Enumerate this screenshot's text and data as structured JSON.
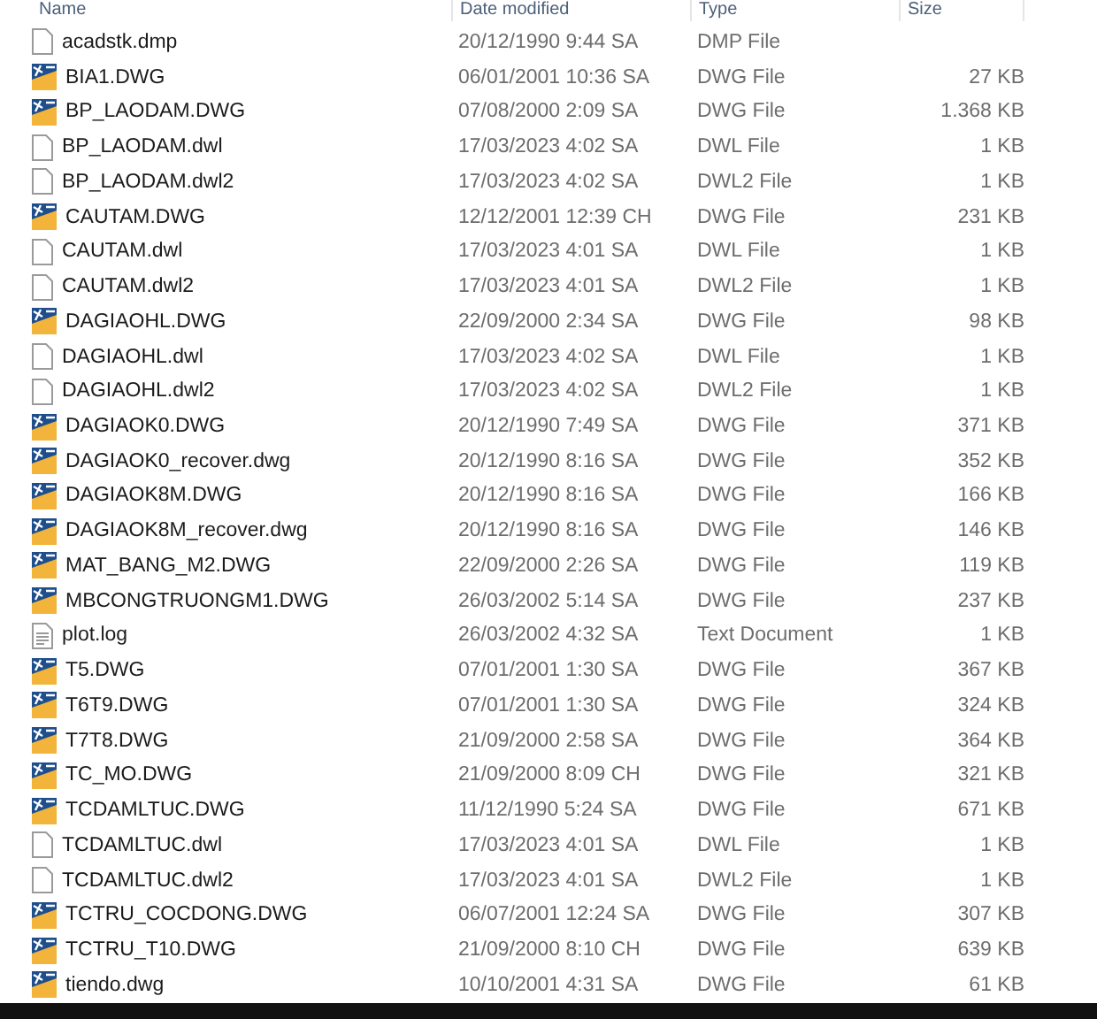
{
  "columns": [
    "Name",
    "Date modified",
    "Type",
    "Size"
  ],
  "files": [
    {
      "kind": "blank",
      "name": "acadstk.dmp",
      "date": "20/12/1990 9:44 SA",
      "type": "DMP File"
    },
    {
      "kind": "dwg",
      "name": "BIA1.DWG",
      "date": "06/01/2001 10:36 SA",
      "type": "DWG File",
      "size": "27 KB"
    },
    {
      "kind": "dwg",
      "name": "BP_LAODAM.DWG",
      "date": "07/08/2000 2:09 SA",
      "type": "DWG File",
      "size": "1.368 KB"
    },
    {
      "kind": "blank",
      "name": "BP_LAODAM.dwl",
      "date": "17/03/2023 4:02 SA",
      "type": "DWL File",
      "size": "1 KB"
    },
    {
      "kind": "blank",
      "name": "BP_LAODAM.dwl2",
      "date": "17/03/2023 4:02 SA",
      "type": "DWL2 File",
      "size": "1 KB"
    },
    {
      "kind": "dwg",
      "name": "CAUTAM.DWG",
      "date": "12/12/2001 12:39 CH",
      "type": "DWG File",
      "size": "231 KB"
    },
    {
      "kind": "blank",
      "name": "CAUTAM.dwl",
      "date": "17/03/2023 4:01 SA",
      "type": "DWL File",
      "size": "1 KB"
    },
    {
      "kind": "blank",
      "name": "CAUTAM.dwl2",
      "date": "17/03/2023 4:01 SA",
      "type": "DWL2 File",
      "size": "1 KB"
    },
    {
      "kind": "dwg",
      "name": "DAGIAOHL.DWG",
      "date": "22/09/2000 2:34 SA",
      "type": "DWG File",
      "size": "98 KB"
    },
    {
      "kind": "blank",
      "name": "DAGIAOHL.dwl",
      "date": "17/03/2023 4:02 SA",
      "type": "DWL File",
      "size": "1 KB"
    },
    {
      "kind": "blank",
      "name": "DAGIAOHL.dwl2",
      "date": "17/03/2023 4:02 SA",
      "type": "DWL2 File",
      "size": "1 KB"
    },
    {
      "kind": "dwg",
      "name": "DAGIAOK0.DWG",
      "date": "20/12/1990 7:49 SA",
      "type": "DWG File",
      "size": "371 KB"
    },
    {
      "kind": "dwg",
      "name": "DAGIAOK0_recover.dwg",
      "date": "20/12/1990 8:16 SA",
      "type": "DWG File",
      "size": "352 KB"
    },
    {
      "kind": "dwg",
      "name": "DAGIAOK8M.DWG",
      "date": "20/12/1990 8:16 SA",
      "type": "DWG File",
      "size": "166 KB"
    },
    {
      "kind": "dwg",
      "name": "DAGIAOK8M_recover.dwg",
      "date": "20/12/1990 8:16 SA",
      "type": "DWG File",
      "size": "146 KB"
    },
    {
      "kind": "dwg",
      "name": "MAT_BANG_M2.DWG",
      "date": "22/09/2000 2:26 SA",
      "type": "DWG File",
      "size": "119 KB"
    },
    {
      "kind": "dwg",
      "name": "MBCONGTRUONGM1.DWG",
      "date": "26/03/2002 5:14 SA",
      "type": "DWG File",
      "size": "237 KB"
    },
    {
      "kind": "text",
      "name": "plot.log",
      "date": "26/03/2002 4:32 SA",
      "type": "Text Document",
      "size": "1 KB"
    },
    {
      "kind": "dwg",
      "name": "T5.DWG",
      "date": "07/01/2001 1:30 SA",
      "type": "DWG File",
      "size": "367 KB"
    },
    {
      "kind": "dwg",
      "name": "T6T9.DWG",
      "date": "07/01/2001 1:30 SA",
      "type": "DWG File",
      "size": "324 KB"
    },
    {
      "kind": "dwg",
      "name": "T7T8.DWG",
      "date": "21/09/2000 2:58 SA",
      "type": "DWG File",
      "size": "364 KB"
    },
    {
      "kind": "dwg",
      "name": "TC_MO.DWG",
      "date": "21/09/2000 8:09 CH",
      "type": "DWG File",
      "size": "321 KB"
    },
    {
      "kind": "dwg",
      "name": "TCDAMLTUC.DWG",
      "date": "11/12/1990 5:24 SA",
      "type": "DWG File",
      "size": "671 KB"
    },
    {
      "kind": "blank",
      "name": "TCDAMLTUC.dwl",
      "date": "17/03/2023 4:01 SA",
      "type": "DWL File",
      "size": "1 KB"
    },
    {
      "kind": "blank",
      "name": "TCDAMLTUC.dwl2",
      "date": "17/03/2023 4:01 SA",
      "type": "DWL2 File",
      "size": "1 KB"
    },
    {
      "kind": "dwg",
      "name": "TCTRU_COCDONG.DWG",
      "date": "06/07/2001 12:24 SA",
      "type": "DWG File",
      "size": "307 KB"
    },
    {
      "kind": "dwg",
      "name": "TCTRU_T10.DWG",
      "date": "21/09/2000 8:10 CH",
      "type": "DWG File",
      "size": "639 KB"
    },
    {
      "kind": "dwg",
      "name": "tiendo.dwg",
      "date": "10/10/2001 4:31 SA",
      "type": "DWG File",
      "size": "61 KB"
    }
  ]
}
